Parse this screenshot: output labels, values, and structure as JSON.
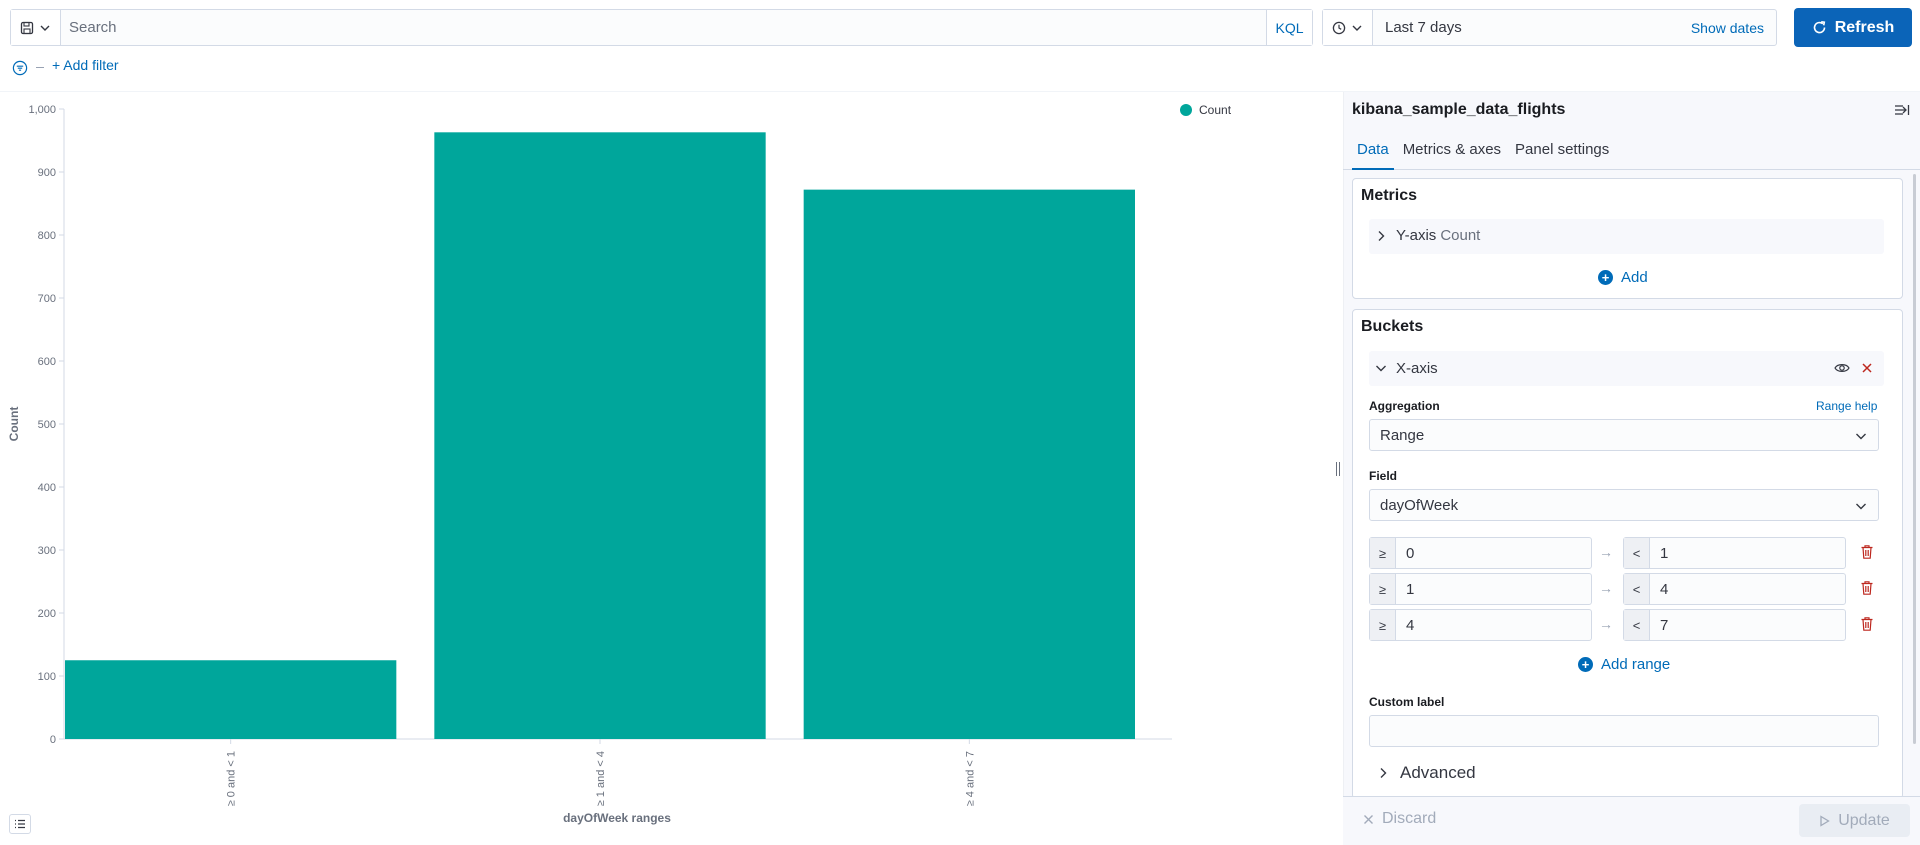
{
  "query": {
    "search_placeholder": "Search",
    "language": "KQL",
    "date_range": "Last 7 days",
    "show_dates": "Show dates",
    "refresh_label": "Refresh"
  },
  "filters": {
    "add_filter": "+ Add filter"
  },
  "chart_data": {
    "type": "bar",
    "categories": [
      "≥ 0 and < 1",
      "≥ 1 and < 4",
      "≥ 4 and < 7"
    ],
    "series": [
      {
        "name": "Count",
        "values": [
          125,
          963,
          872
        ],
        "color": "#00a69b"
      }
    ],
    "xlabel": "dayOfWeek ranges",
    "ylabel": "Count",
    "ylim": [
      0,
      1000
    ],
    "yticks": [
      "0",
      "100",
      "200",
      "300",
      "400",
      "500",
      "600",
      "700",
      "800",
      "900",
      "1,000"
    ],
    "legend": "top-right",
    "grid": false
  },
  "sidebar": {
    "index_pattern": "kibana_sample_data_flights",
    "tabs": [
      "Data",
      "Metrics & axes",
      "Panel settings"
    ],
    "active_tab": "Data",
    "metrics": {
      "title": "Metrics",
      "y_axis_label": "Y-axis",
      "y_axis_value": "Count",
      "add_label": "Add"
    },
    "buckets": {
      "title": "Buckets",
      "x_axis_label": "X-axis",
      "aggregation_label": "Aggregation",
      "range_help": "Range help",
      "aggregation_value": "Range",
      "field_label": "Field",
      "field_value": "dayOfWeek",
      "ranges": [
        {
          "gte_symbol": "≥",
          "from": "0",
          "lt_symbol": "<",
          "to": "1"
        },
        {
          "gte_symbol": "≥",
          "from": "1",
          "lt_symbol": "<",
          "to": "4"
        },
        {
          "gte_symbol": "≥",
          "from": "4",
          "lt_symbol": "<",
          "to": "7"
        }
      ],
      "add_range": "Add range",
      "custom_label": "Custom label",
      "custom_label_value": "",
      "advanced": "Advanced"
    },
    "footer": {
      "discard": "Discard",
      "update": "Update"
    }
  }
}
